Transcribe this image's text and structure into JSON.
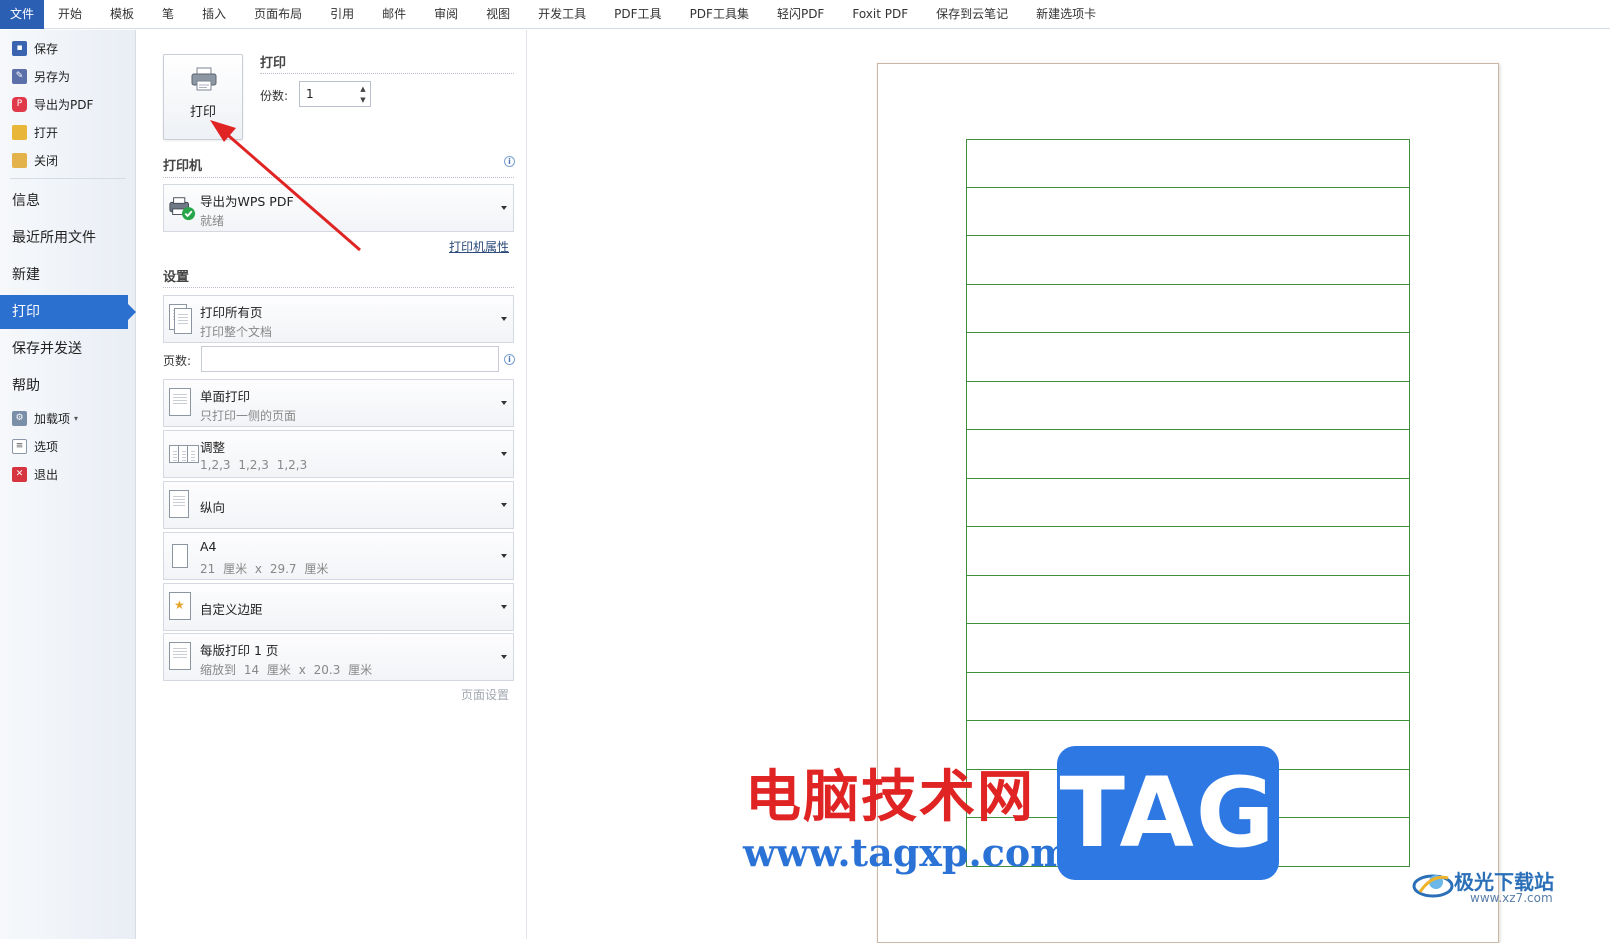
{
  "ribbon": {
    "tabs": [
      "文件",
      "开始",
      "模板",
      "笔",
      "插入",
      "页面布局",
      "引用",
      "邮件",
      "审阅",
      "视图",
      "开发工具",
      "PDF工具",
      "PDF工具集",
      "轻闪PDF",
      "Foxit PDF",
      "保存到云笔记",
      "新建选项卡"
    ]
  },
  "sidebar": {
    "top_items": [
      "保存",
      "另存为",
      "导出为PDF",
      "打开",
      "关闭"
    ],
    "big_items": [
      "信息",
      "最近所用文件",
      "新建",
      "打印",
      "保存并发送",
      "帮助"
    ],
    "bottom_items": [
      "加载项",
      "选项",
      "退出"
    ],
    "active": "打印"
  },
  "print": {
    "button_label": "打印",
    "section_title": "打印",
    "copies_label": "份数:",
    "copies_value": "1"
  },
  "printer": {
    "section_title": "打印机",
    "name": "导出为WPS PDF",
    "status": "就绪",
    "properties_link": "打印机属性"
  },
  "settings": {
    "section_title": "设置",
    "pages_label": "页数:",
    "items": [
      {
        "title": "打印所有页",
        "subtitle": "打印整个文档"
      },
      {
        "title": "单面打印",
        "subtitle": "只打印一侧的页面"
      },
      {
        "title": "调整",
        "subtitle": "1,2,3    1,2,3    1,2,3"
      },
      {
        "title": "纵向",
        "subtitle": ""
      },
      {
        "title": "A4",
        "subtitle": "21 厘米 x 29.7 厘米"
      },
      {
        "title": "自定义边距",
        "subtitle": ""
      },
      {
        "title": "每版打印 1 页",
        "subtitle": "缩放到 14 厘米 x 20.3 厘米"
      }
    ],
    "page_setup_link": "页面设置"
  },
  "preview": {
    "table_rows": 15,
    "line_color": "#3f8f3f"
  },
  "watermark": {
    "cn_text": "电脑技术网",
    "url": "www.tagxp.com",
    "tag": "TAG",
    "site_name": "极光下载站",
    "site_url": "www.xz7.com"
  },
  "colors": {
    "accent": "#2b6fcf",
    "arrow": "#e02424"
  }
}
